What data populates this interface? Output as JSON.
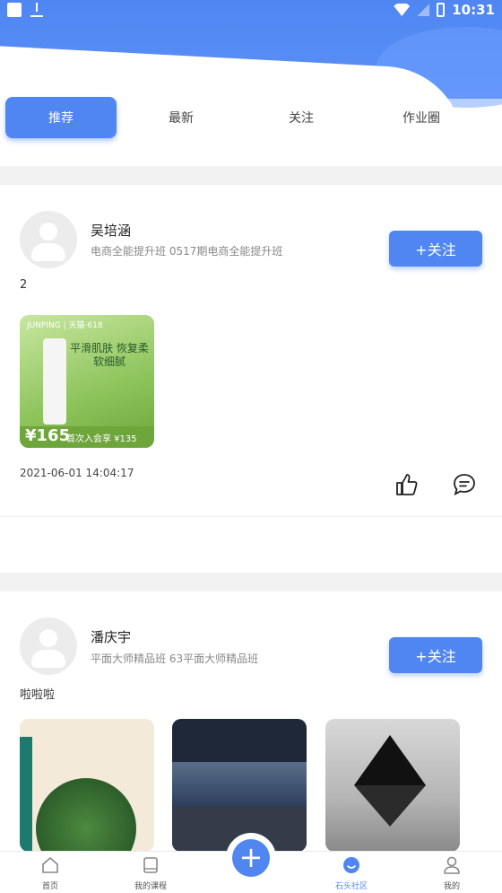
{
  "status_bar": {
    "time": "10:31"
  },
  "tabs": [
    {
      "label": "推荐",
      "active": true
    },
    {
      "label": "最新",
      "active": false
    },
    {
      "label": "关注",
      "active": false
    },
    {
      "label": "作业圈",
      "active": false
    }
  ],
  "posts": [
    {
      "author": "吴培涵",
      "class_info": "电商全能提升班 0517期电商全能提升班",
      "follow_label": "+关注",
      "text": "2",
      "image": {
        "brand": "JUNPING | 天猫·618",
        "promo": "平滑肌肤 恢复柔软细腻",
        "price": "¥165",
        "banner": "首次入会享 ¥135"
      },
      "date": "2021-06-01 14:04:17"
    },
    {
      "author": "潘庆宇",
      "class_info": "平面大师精品班 63平面大师精品班",
      "follow_label": "+关注",
      "text": "啦啦啦"
    }
  ],
  "bottom_nav": [
    {
      "label": "首页",
      "icon": "home-icon"
    },
    {
      "label": "我的课程",
      "icon": "book-icon"
    },
    {
      "label": "石头社区",
      "icon": "community-icon",
      "active": true
    },
    {
      "label": "我的",
      "icon": "user-icon"
    }
  ],
  "colors": {
    "accent": "#4f86f2"
  }
}
